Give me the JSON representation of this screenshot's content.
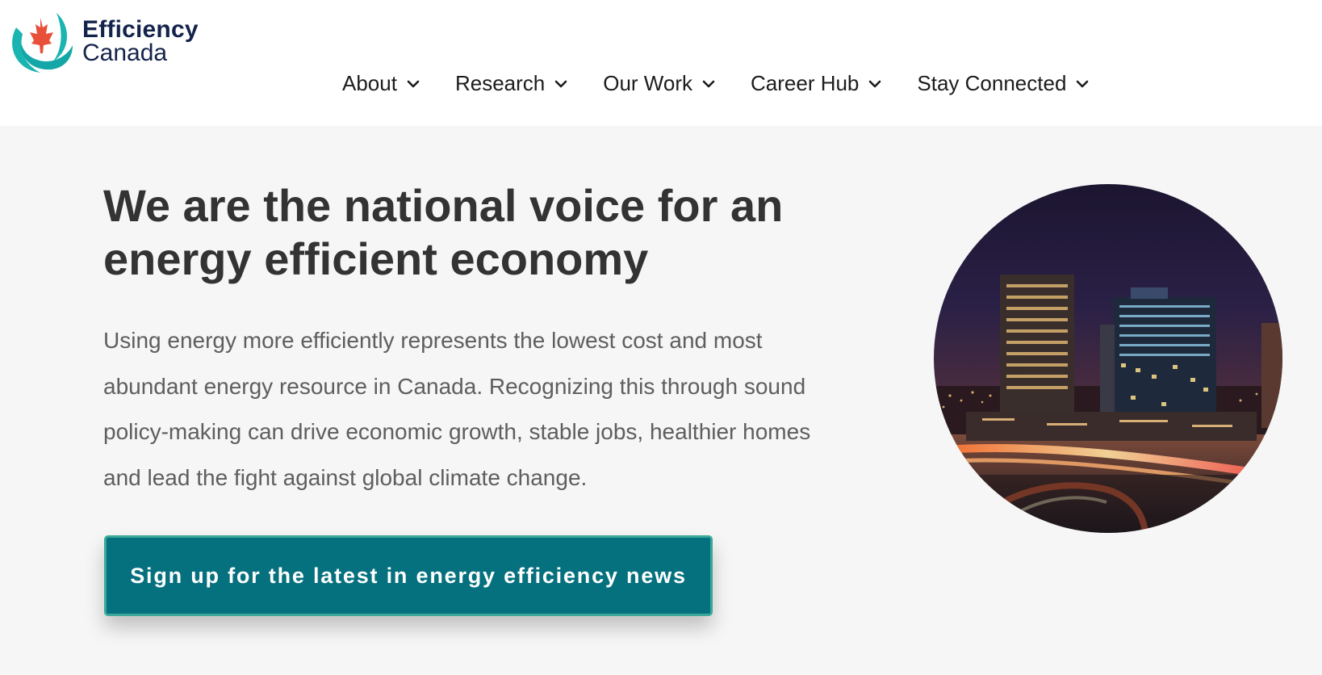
{
  "brand": {
    "name_line1": "Efficiency",
    "name_line2": "Canada",
    "colors": {
      "teal": "#1bb5b1",
      "maple": "#e8503a",
      "navy": "#14234b"
    }
  },
  "nav": {
    "items": [
      {
        "label": "About",
        "icon": "chevron-down-icon"
      },
      {
        "label": "Research",
        "icon": "chevron-down-icon"
      },
      {
        "label": "Our Work",
        "icon": "chevron-down-icon"
      },
      {
        "label": "Career Hub",
        "icon": "chevron-down-icon"
      },
      {
        "label": "Stay Connected",
        "icon": "chevron-down-icon"
      }
    ]
  },
  "hero": {
    "title": "We are the national voice for an energy efficient economy",
    "body": "Using energy more efficiently represents the lowest cost and most abundant energy resource in Canada. Recognizing this through sound policy-making can drive economic growth, stable jobs, healthier homes and lead the fight against global climate change.",
    "cta_label": "Sign up for the latest in energy efficiency news",
    "image": "city-night-skyline",
    "colors": {
      "cta_background": "#05707e",
      "cta_border": "#3aa89a",
      "title": "#333333",
      "body": "#5e5e5e"
    }
  }
}
